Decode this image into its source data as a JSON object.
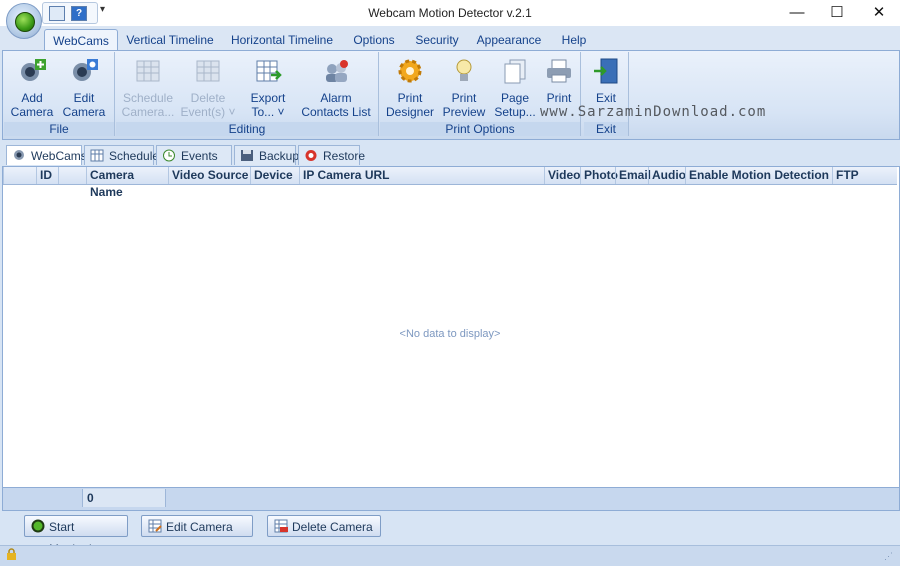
{
  "window": {
    "title": "Webcam Motion Detector v.2.1",
    "controls": [
      "—",
      "☐",
      "✕"
    ]
  },
  "ribbon_tabs": [
    "WebCams",
    "Vertical Timeline",
    "Horizontal Timeline",
    "Options",
    "Security",
    "Appearance",
    "Help"
  ],
  "groups": {
    "file": {
      "label": "File",
      "buttons": [
        {
          "l1": "Add",
          "l2": "Camera",
          "icon": "add-camera-icon"
        },
        {
          "l1": "Edit",
          "l2": "Camera",
          "icon": "edit-camera-icon"
        }
      ]
    },
    "editing": {
      "label": "Editing",
      "buttons": [
        {
          "l1": "Schedule",
          "l2": "Camera...",
          "icon": "schedule-icon"
        },
        {
          "l1": "Delete",
          "l2": "Event(s) ˅",
          "icon": "delete-event-icon"
        },
        {
          "l1": "Export",
          "l2": "To... ˅",
          "icon": "export-icon"
        },
        {
          "l1": "Alarm",
          "l2": "Contacts List",
          "icon": "alarm-contacts-icon"
        }
      ]
    },
    "print": {
      "label": "Print Options",
      "buttons": [
        {
          "l1": "Print",
          "l2": "Designer",
          "icon": "gear-icon"
        },
        {
          "l1": "Print",
          "l2": "Preview",
          "icon": "bulb-icon"
        },
        {
          "l1": "Page",
          "l2": "Setup...",
          "icon": "pages-icon"
        },
        {
          "l1": "Print",
          "l2": "",
          "icon": "printer-icon"
        }
      ]
    },
    "exit": {
      "label": "Exit",
      "buttons": [
        {
          "l1": "Exit",
          "l2": "",
          "icon": "exit-door-icon"
        }
      ]
    }
  },
  "doc_tabs": [
    "WebCams",
    "Scheduler",
    "Events List",
    "Backup",
    "Restore"
  ],
  "grid": {
    "columns": [
      "ID",
      "Camera Name",
      "Video Source",
      "Device",
      "IP Camera URL",
      "Video",
      "Photo",
      "Email",
      "Audio",
      "Enable Motion Detection",
      "FTP"
    ],
    "empty_text": "<No data to display>",
    "count": "0"
  },
  "bottom_buttons": [
    "Start Monitoring",
    "Edit Camera",
    "Delete Camera"
  ],
  "watermark": "www.SarzaminDownload.com",
  "colors": {
    "accent": "#15428b",
    "ribbon_bg": "#d7e4f5",
    "border": "#8eacd5"
  }
}
